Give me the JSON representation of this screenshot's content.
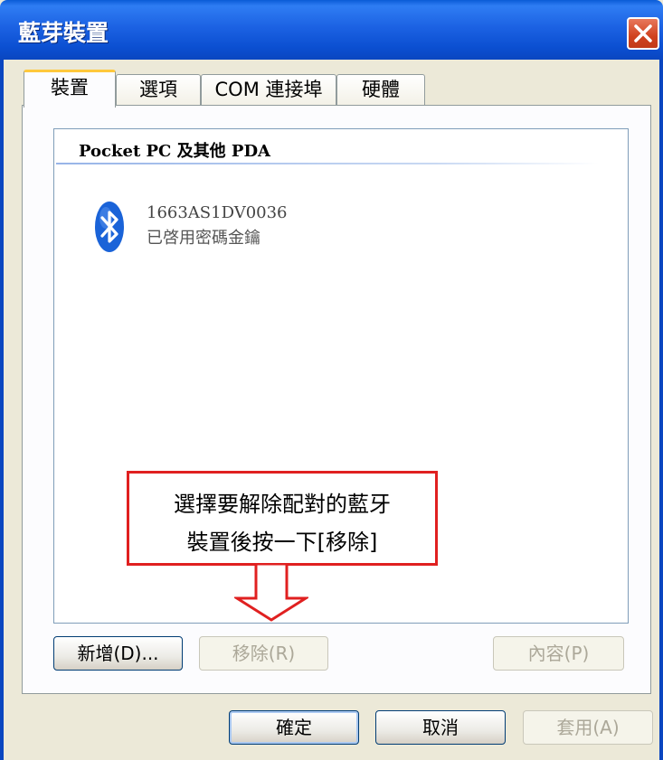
{
  "window": {
    "title": "藍芽裝置",
    "close_label": "close"
  },
  "tabs": [
    {
      "label": "裝置",
      "active": true
    },
    {
      "label": "選項",
      "active": false
    },
    {
      "label": "COM 連接埠",
      "active": false
    },
    {
      "label": "硬體",
      "active": false
    }
  ],
  "device_list": {
    "group_header": "Pocket PC 及其他 PDA",
    "devices": [
      {
        "name": "1663AS1DV0036",
        "status": "已啓用密碼金鑰",
        "icon": "bluetooth-icon"
      }
    ]
  },
  "annotation": {
    "line1": "選擇要解除配對的藍牙",
    "line2": "裝置後按一下[移除]",
    "color": "#e02020"
  },
  "panel_buttons": {
    "add": "新增(D)...",
    "remove": "移除(R)",
    "properties": "內容(P)"
  },
  "dialog_buttons": {
    "ok": "確定",
    "cancel": "取消",
    "apply": "套用(A)"
  },
  "colors": {
    "titlebar": "#0a5bd6",
    "face": "#ece9d8",
    "tab_highlight": "#ffc83c"
  }
}
